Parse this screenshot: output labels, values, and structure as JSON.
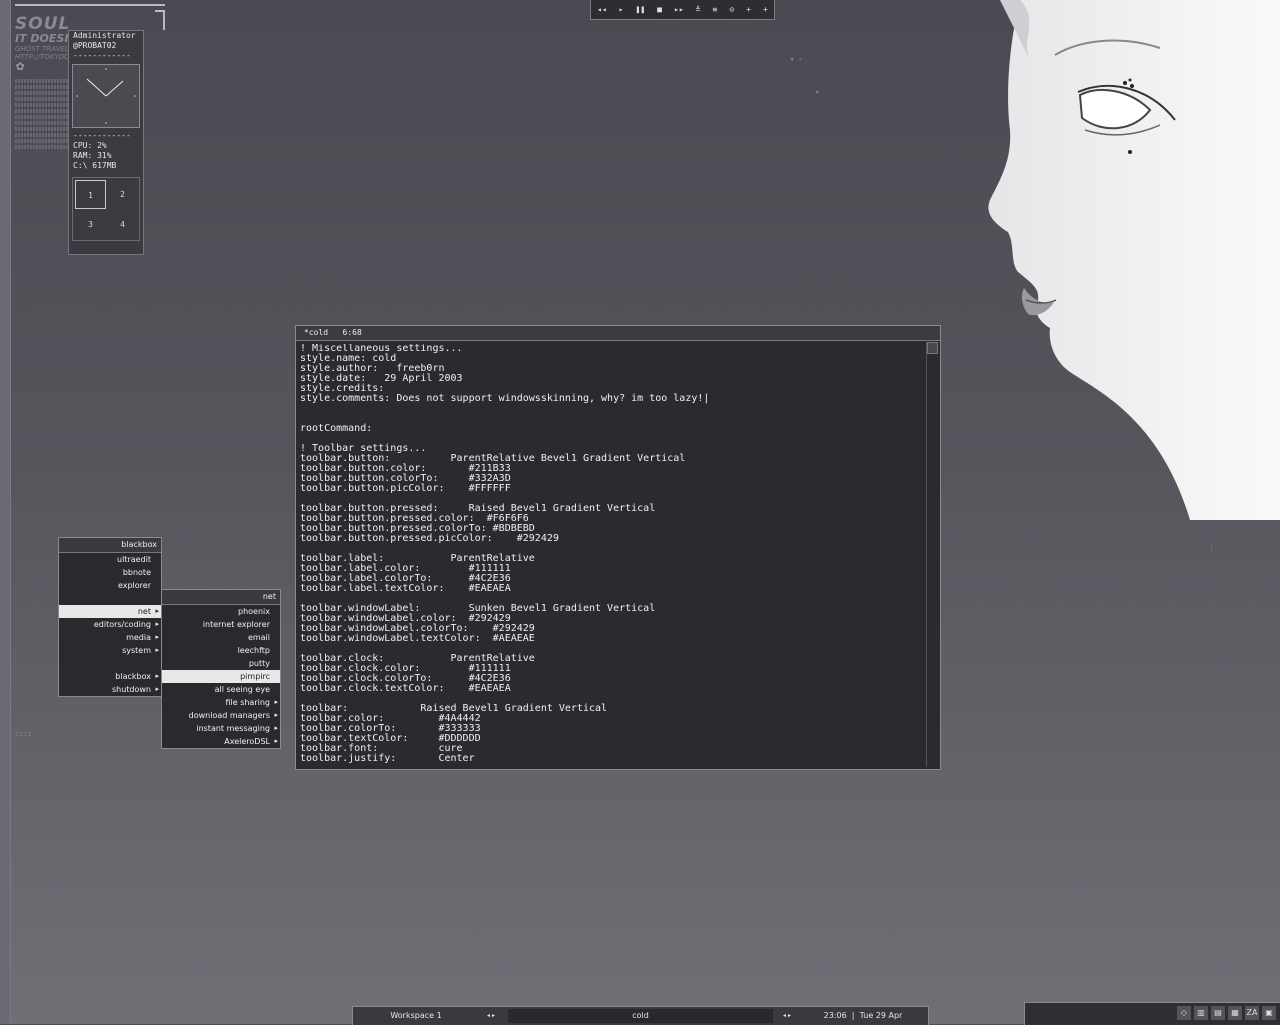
{
  "desktop": {
    "soul_text": {
      "line1": "SOUL",
      "line2": "IT DOESN'T",
      "line3": "GHOST TRAVELER",
      "line4": "HTTP://TOKYOCORE"
    }
  },
  "sysmon": {
    "user": "Administrator",
    "host": "@PROBAT02",
    "divider": "------------",
    "cpu": "CPU: 2%",
    "ram": "RAM: 31%",
    "disk": "C:\\ 617MB",
    "workspaces": [
      "1",
      "2",
      "3",
      "4"
    ]
  },
  "mediabar": {
    "buttons": [
      "◂◂",
      "▸",
      "❚❚",
      "■",
      "▸▸",
      "≚",
      "≡",
      "⊙",
      "+",
      "+"
    ]
  },
  "terminal": {
    "title": "*cold   6:68",
    "lines": [
      "! Miscellaneous settings...",
      "style.name: cold",
      "style.author:   freeb0rn",
      "style.date:   29 April 2003",
      "style.credits:",
      "style.comments: Does not support windowsskinning, why? im too lazy!|",
      "",
      "",
      "rootCommand:",
      "",
      "! Toolbar settings...",
      "toolbar.button:          ParentRelative Bevel1 Gradient Vertical",
      "toolbar.button.color:       #211B33",
      "toolbar.button.colorTo:     #332A3D",
      "toolbar.button.picColor:    #FFFFFF",
      "",
      "toolbar.button.pressed:     Raised Bevel1 Gradient Vertical",
      "toolbar.button.pressed.color:  #F6F6F6",
      "toolbar.button.pressed.colorTo: #BDBEBD",
      "toolbar.button.pressed.picColor:    #292429",
      "",
      "toolbar.label:           ParentRelative",
      "toolbar.label.color:        #111111",
      "toolbar.label.colorTo:      #4C2E36",
      "toolbar.label.textColor:    #EAEAEA",
      "",
      "toolbar.windowLabel:        Sunken Bevel1 Gradient Vertical",
      "toolbar.windowLabel.color:  #292429",
      "toolbar.windowLabel.colorTo:    #292429",
      "toolbar.windowLabel.textColor:  #AEAEAE",
      "",
      "toolbar.clock:           ParentRelative",
      "toolbar.clock.color:        #111111",
      "toolbar.clock.colorTo:      #4C2E36",
      "toolbar.clock.textColor:    #EAEAEA",
      "",
      "toolbar:            Raised Bevel1 Gradient Vertical",
      "toolbar.color:         #4A4442",
      "toolbar.colorTo:       #333333",
      "toolbar.textColor:     #DDDDDD",
      "toolbar.font:          cure",
      "toolbar.justify:       Center"
    ]
  },
  "menu_main": {
    "title": "blackbox",
    "items": [
      {
        "label": "ultraedit",
        "sub": false
      },
      {
        "label": "bbnote",
        "sub": false
      },
      {
        "label": "explorer",
        "sub": false
      },
      {
        "label": "",
        "sub": false,
        "gap": true
      },
      {
        "label": "net",
        "sub": true,
        "selected": true
      },
      {
        "label": "editors/coding",
        "sub": true
      },
      {
        "label": "media",
        "sub": true
      },
      {
        "label": "system",
        "sub": true
      },
      {
        "label": "",
        "sub": false,
        "gap": true
      },
      {
        "label": "blackbox",
        "sub": true
      },
      {
        "label": "shutdown",
        "sub": true
      }
    ]
  },
  "menu_net": {
    "title": "net",
    "items": [
      {
        "label": "phoenix",
        "sub": false
      },
      {
        "label": "internet explorer",
        "sub": false
      },
      {
        "label": "email",
        "sub": false
      },
      {
        "label": "leechftp",
        "sub": false
      },
      {
        "label": "putty",
        "sub": false
      },
      {
        "label": "pimpirc",
        "sub": false,
        "selected": true
      },
      {
        "label": "all seeing eye",
        "sub": false
      },
      {
        "label": "file sharing",
        "sub": true
      },
      {
        "label": "download managers",
        "sub": true
      },
      {
        "label": "instant messaging",
        "sub": true
      },
      {
        "label": "AxeleroDSL",
        "sub": true
      }
    ]
  },
  "toolbar": {
    "workspace": "Workspace 1",
    "arrows": "◂  ▸",
    "window": "cold",
    "time": "23:06",
    "date": "Tue 29 Apr"
  },
  "tray": {
    "icons": [
      "◇",
      "▥",
      "▤",
      "▦",
      "ZA",
      "▣"
    ]
  },
  "colors": {
    "terminal_bg": "#2c2a2e",
    "menu_selected": "#e8e8e8"
  }
}
